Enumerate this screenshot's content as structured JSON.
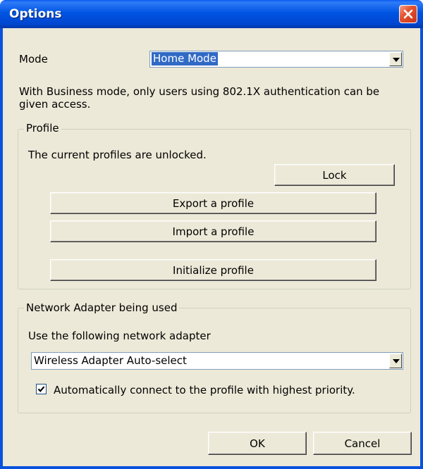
{
  "window": {
    "title": "Options"
  },
  "mode": {
    "label": "Mode",
    "selected": "Home Mode",
    "note_line1": "With Business mode, only users using 802.1X authentication can be",
    "note_line2": "given access."
  },
  "profile": {
    "group_title": "Profile",
    "status": "The current profiles are unlocked.",
    "lock_label": "Lock",
    "export_label": "Export a profile",
    "import_label": "Import a profile",
    "initialize_label": "Initialize profile"
  },
  "adapter": {
    "group_title": "Network Adapter being used",
    "use_label": "Use the following network adapter",
    "selected": "Wireless Adapter Auto-select",
    "auto_connect_label": "Automatically connect to the profile with highest priority.",
    "auto_connect_checked": true
  },
  "footer": {
    "ok_label": "OK",
    "cancel_label": "Cancel"
  }
}
